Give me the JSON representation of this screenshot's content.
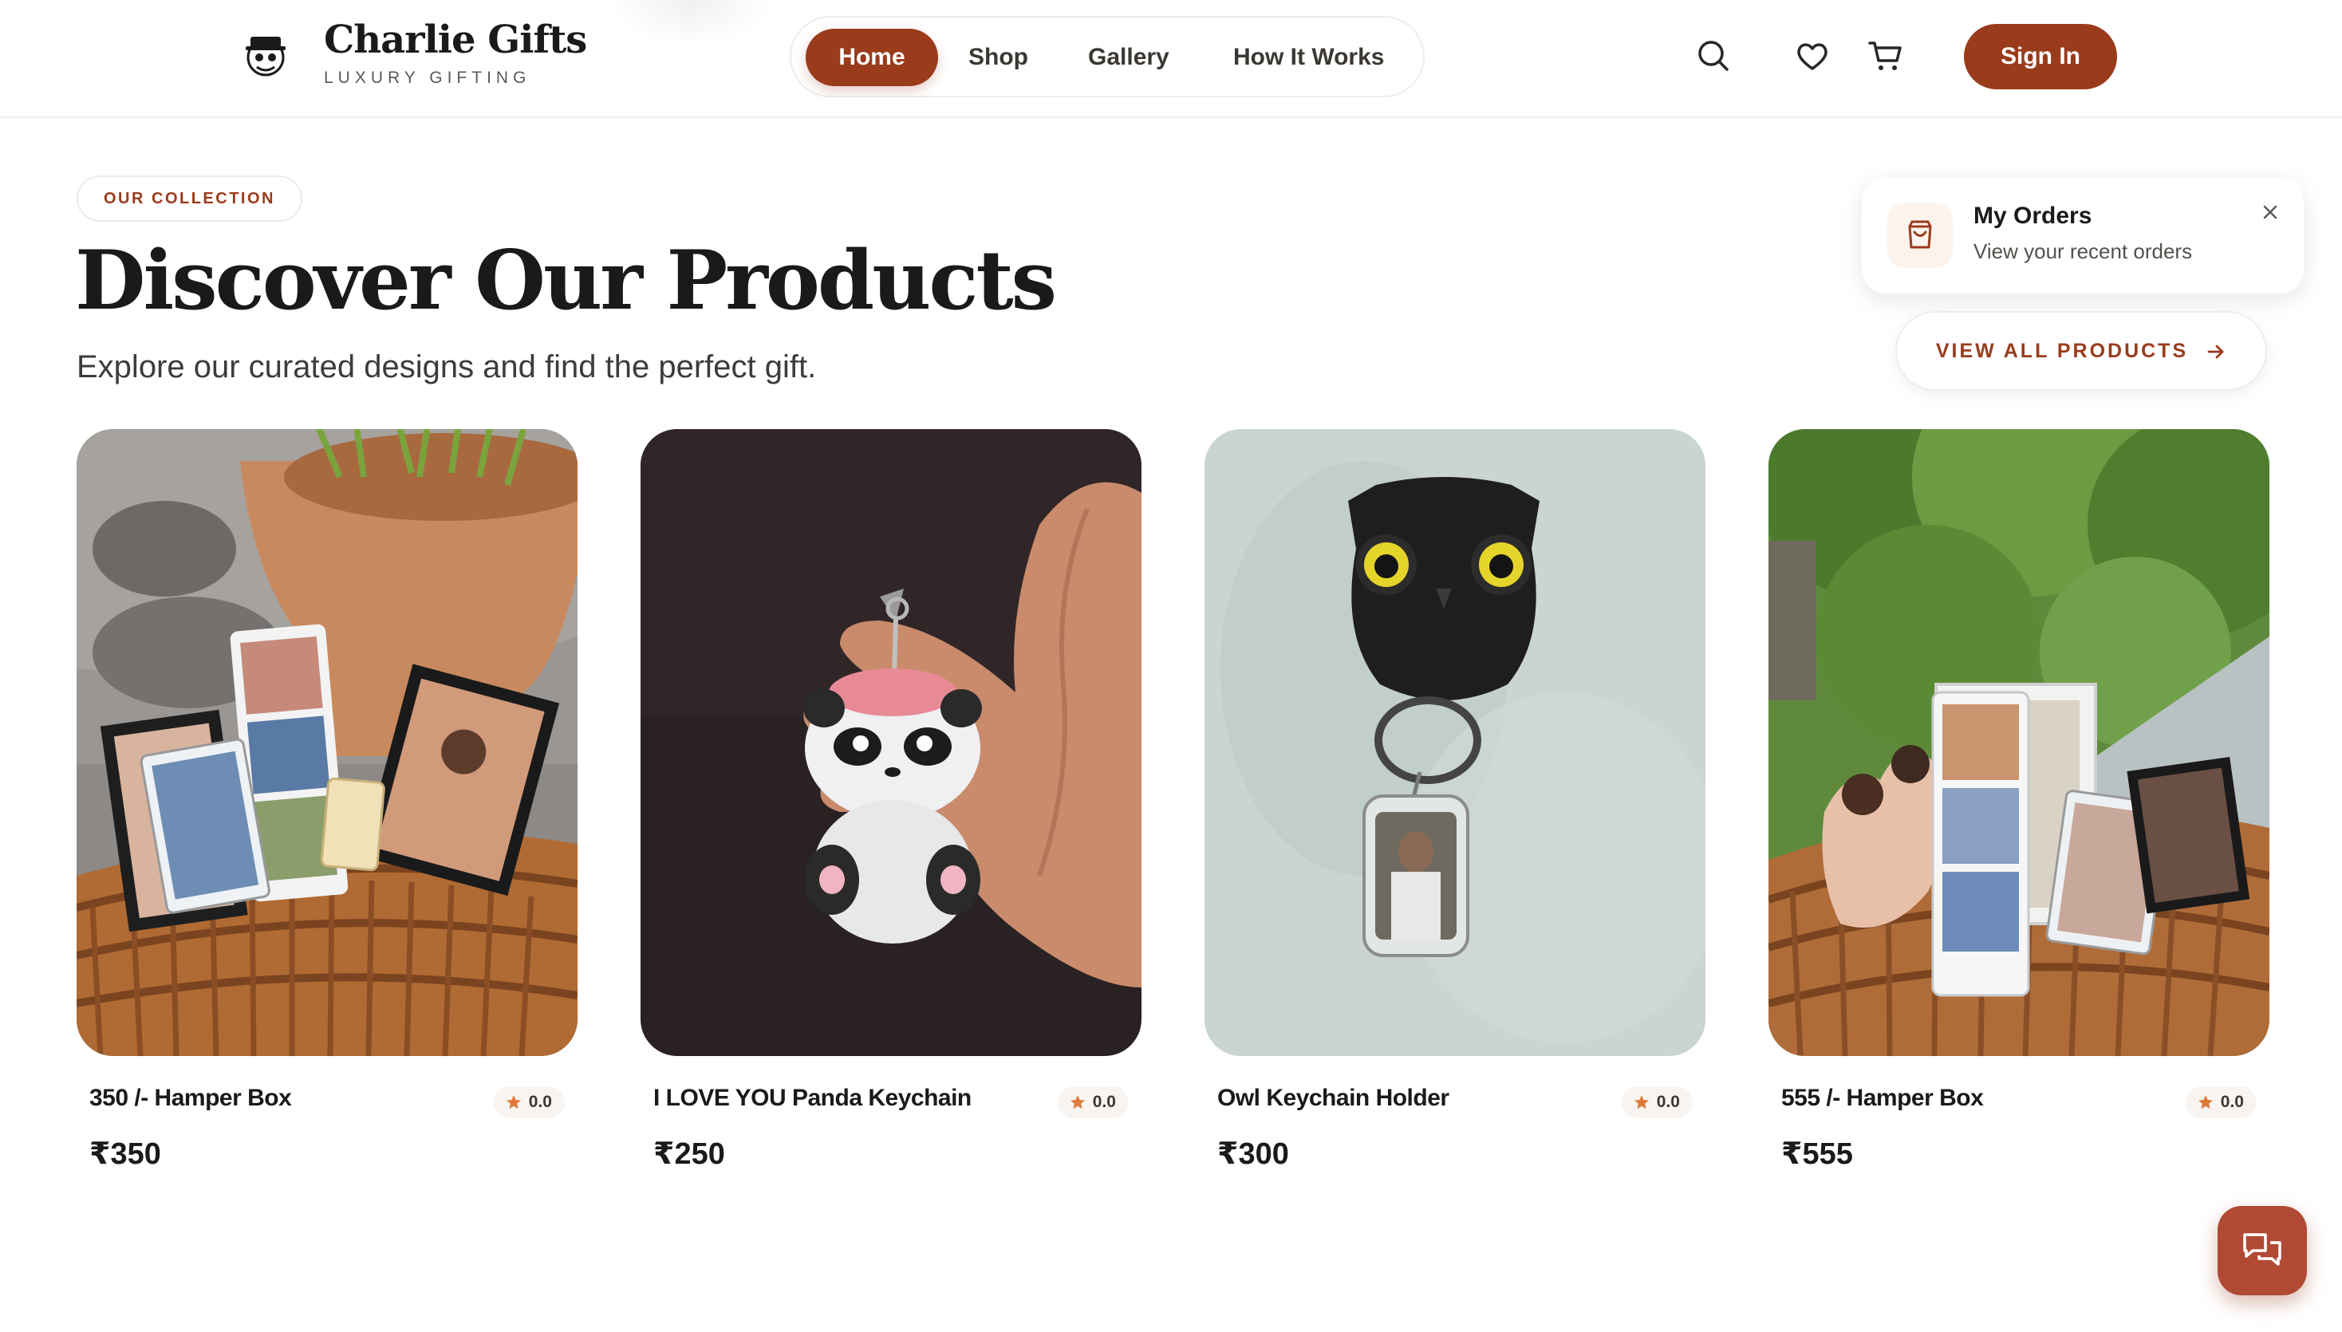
{
  "brand": {
    "name": "Charlie Gifts",
    "tagline": "LUXURY GIFTING"
  },
  "nav": {
    "items": [
      "Home",
      "Shop",
      "Gallery",
      "How It Works"
    ],
    "active": "Home"
  },
  "header": {
    "sign_in_label": "Sign In",
    "icons": [
      "search-icon",
      "heart-icon",
      "cart-icon"
    ]
  },
  "section": {
    "eyebrow": "OUR COLLECTION",
    "title": "Discover Our Products",
    "subtitle": "Explore our curated designs and find the perfect gift.",
    "view_all_label": "VIEW ALL PRODUCTS"
  },
  "toast": {
    "title": "My Orders",
    "subtitle": "View your recent orders"
  },
  "products": [
    {
      "name": "350 /- Hamper Box",
      "rating": "0.0",
      "price": "₹350"
    },
    {
      "name": "I LOVE YOU Panda Keychain",
      "rating": "0.0",
      "price": "₹250"
    },
    {
      "name": "Owl Keychain Holder",
      "rating": "0.0",
      "price": "₹300"
    },
    {
      "name": "555 /- Hamper Box",
      "rating": "0.0",
      "price": "₹555"
    }
  ],
  "colors": {
    "accent": "#9a3b1c",
    "fab": "#b04a34",
    "star": "#e07a3a",
    "text": "#1c1a19"
  }
}
